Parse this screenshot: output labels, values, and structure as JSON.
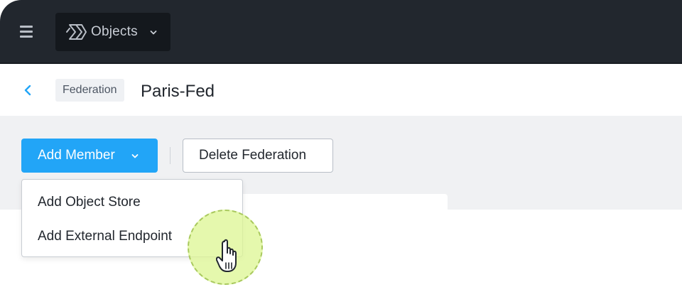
{
  "topbar": {
    "menu_icon": "hamburger-icon",
    "app_icon": "objects-logo-icon",
    "app_title": "Objects",
    "app_chevron": "chevron-down-icon",
    "background": "#22272e"
  },
  "header": {
    "back_icon": "chevron-left-icon",
    "breadcrumb": "Federation",
    "title": "Paris-Fed"
  },
  "toolbar": {
    "add_member_label": "Add Member",
    "add_member_chevron": "chevron-down-icon",
    "delete_label": "Delete Federation",
    "accent": "#22a5f7"
  },
  "dropdown": {
    "items": [
      {
        "label": "Add Object Store"
      },
      {
        "label": "Add External Endpoint"
      }
    ]
  },
  "cursor": {
    "icon": "hand-pointer-icon",
    "highlight": "#dcf591"
  }
}
